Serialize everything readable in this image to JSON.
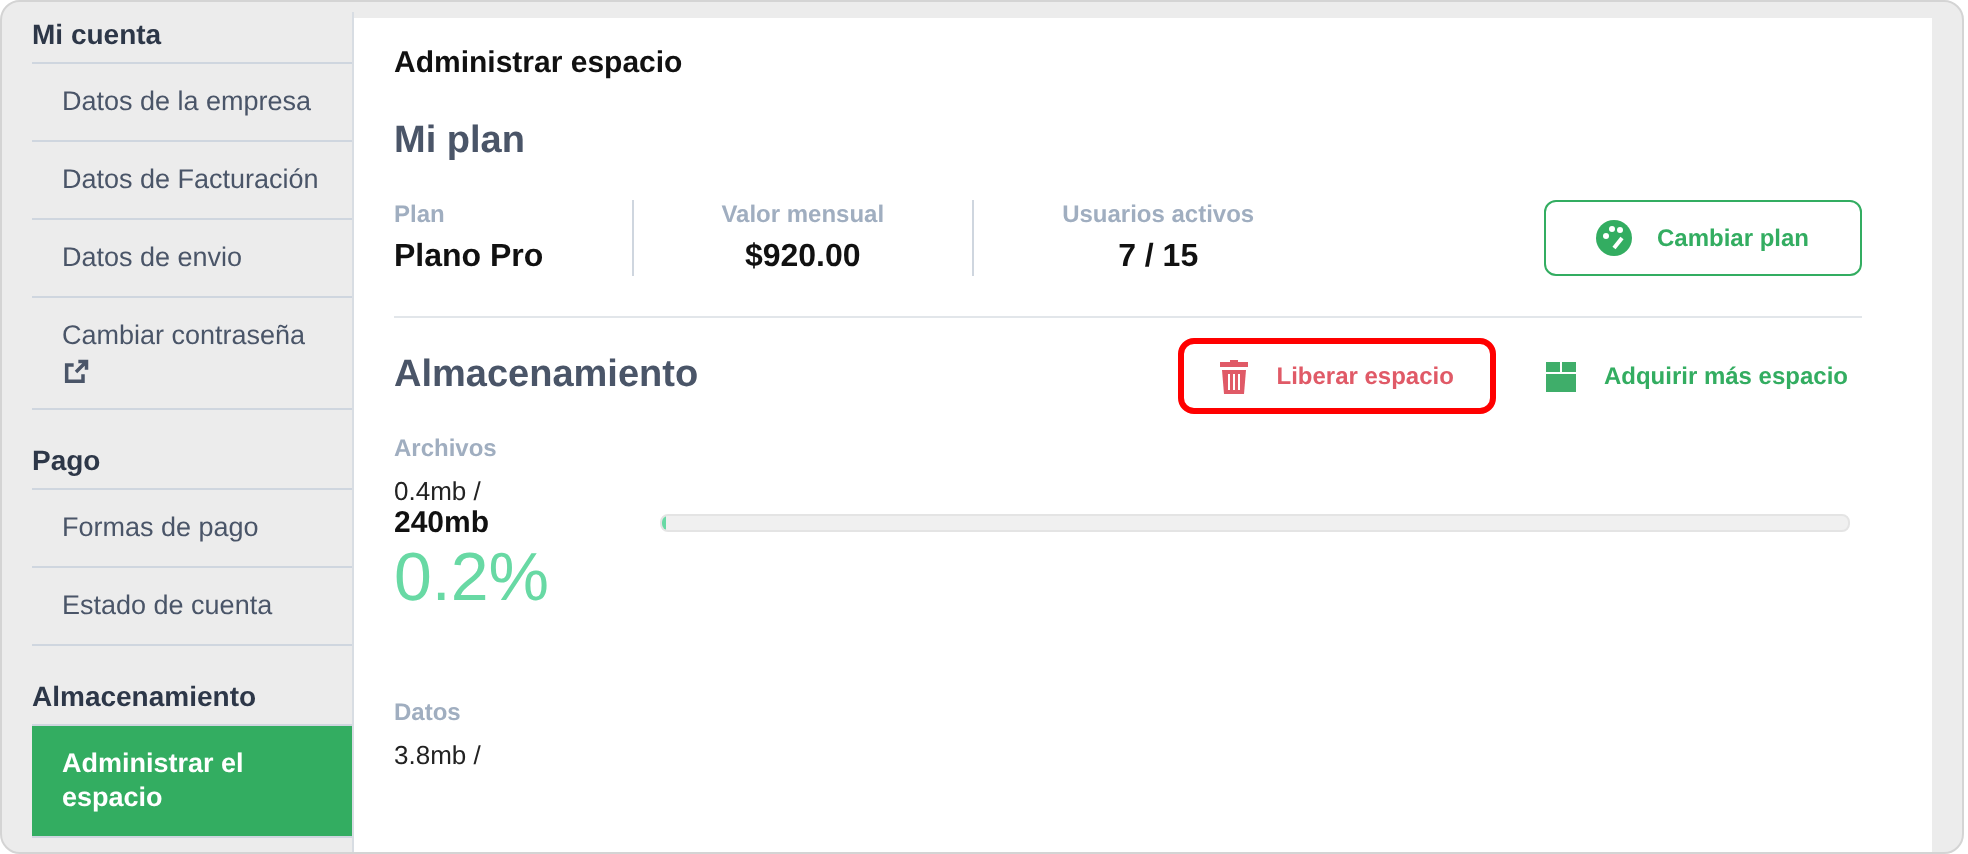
{
  "sidebar": {
    "sections": [
      {
        "title": "Mi cuenta",
        "items": [
          {
            "label": "Datos de la empresa",
            "selected": false,
            "external": false
          },
          {
            "label": "Datos de Facturación",
            "selected": false,
            "external": false
          },
          {
            "label": "Datos de envio",
            "selected": false,
            "external": false
          },
          {
            "label": "Cambiar contraseña",
            "selected": false,
            "external": true
          }
        ]
      },
      {
        "title": "Pago",
        "items": [
          {
            "label": "Formas de pago",
            "selected": false,
            "external": false
          },
          {
            "label": "Estado de cuenta",
            "selected": false,
            "external": false
          }
        ]
      },
      {
        "title": "Almacenamiento",
        "items": [
          {
            "label": "Administrar el espacio",
            "selected": true,
            "external": false
          }
        ]
      }
    ]
  },
  "page_title": "Administrar espacio",
  "plan": {
    "heading": "Mi plan",
    "stats": [
      {
        "label": "Plan",
        "value": "Plano Pro"
      },
      {
        "label": "Valor mensual",
        "value": "$920.00"
      },
      {
        "label": "Usuarios activos",
        "value": "7 / 15"
      }
    ],
    "button": "Cambiar plan"
  },
  "storage": {
    "heading": "Almacenamiento",
    "actions": [
      {
        "kind": "free",
        "label": "Liberar espacio",
        "highlighted": true
      },
      {
        "kind": "buy",
        "label": "Adquirir más espacio",
        "highlighted": false
      }
    ],
    "items": [
      {
        "label": "Archivos",
        "used": "0.4mb /",
        "total": "240mb",
        "percent": "0.2%",
        "level": 0.002
      },
      {
        "label": "Datos",
        "used": "3.8mb /"
      }
    ]
  }
}
